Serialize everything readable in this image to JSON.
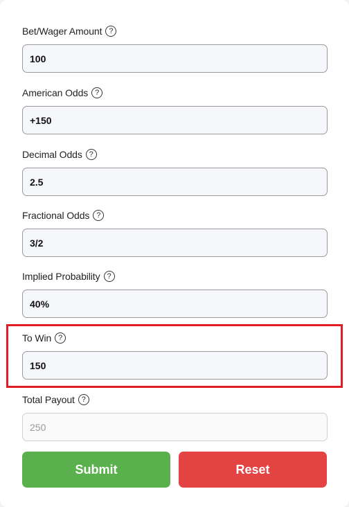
{
  "fields": {
    "bet": {
      "label": "Bet/Wager Amount",
      "value": "100"
    },
    "american": {
      "label": "American Odds",
      "value": "+150"
    },
    "decimal": {
      "label": "Decimal Odds",
      "value": "2.5"
    },
    "fractional": {
      "label": "Fractional Odds",
      "value": "3/2"
    },
    "implied": {
      "label": "Implied Probability",
      "value": "40%"
    },
    "towin": {
      "label": "To Win",
      "value": "150"
    },
    "payout": {
      "label": "Total Payout",
      "placeholder": "250"
    }
  },
  "help_glyph": "?",
  "buttons": {
    "submit": "Submit",
    "reset": "Reset"
  },
  "colors": {
    "submit": "#5ab04c",
    "reset": "#e34343",
    "highlight": "#e01b22"
  },
  "icons": {
    "help": "question-circle-icon"
  }
}
